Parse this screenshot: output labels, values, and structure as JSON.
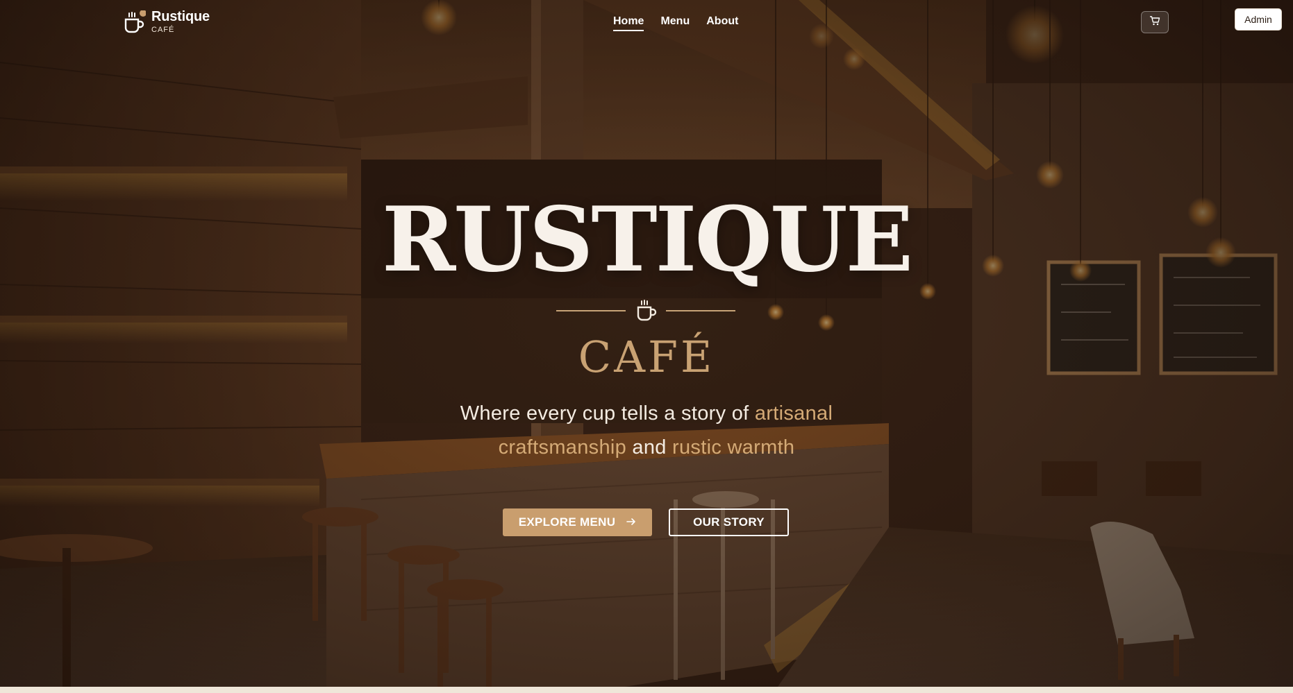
{
  "brand": {
    "name": "Rustique",
    "sub": "CAFÉ"
  },
  "nav": {
    "items": [
      {
        "label": "Home",
        "active": true
      },
      {
        "label": "Menu",
        "active": false
      },
      {
        "label": "About",
        "active": false
      }
    ],
    "cart_icon": "cart-icon",
    "admin_label": "Admin"
  },
  "hero": {
    "title": "RUSTIQUE",
    "divider_icon": "coffee-cup-icon",
    "subtitle": "CAFÉ",
    "tagline": {
      "part1": "Where every cup tells a story of ",
      "highlight1": "artisanal craftsmanship",
      "part2": " and ",
      "highlight2": "rustic warmth"
    },
    "primary_button": "EXPLORE MENU",
    "primary_button_icon": "arrow-right-icon",
    "secondary_button": "OUR STORY"
  },
  "colors": {
    "accent": "#c99e6e",
    "text_light": "#f7f1ea",
    "page_bg": "#efe6d9"
  }
}
